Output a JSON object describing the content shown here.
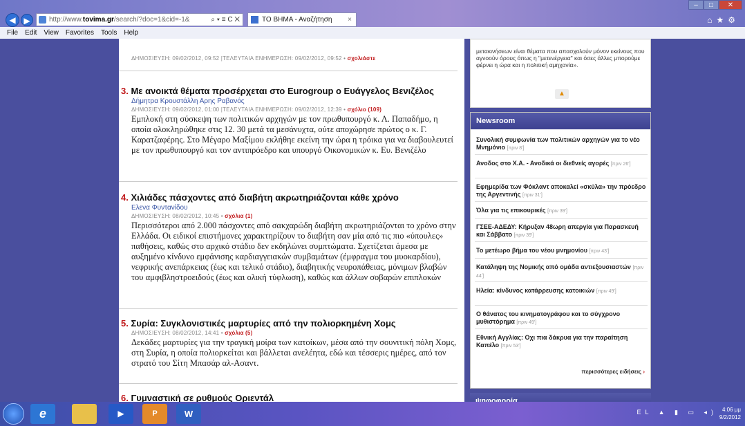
{
  "browser": {
    "address_url_prefix": "http://www.",
    "address_url_domain": "tovima.gr",
    "address_url_rest": "/search/?doc=1&cid=-1&",
    "address_controls": "⌕ ▾ ≡ C ✕",
    "tab_title": "ΤΟ ΒΗΜΑ - Αναζήτηση",
    "tab_close": "×",
    "menu": [
      "File",
      "Edit",
      "View",
      "Favorites",
      "Tools",
      "Help"
    ]
  },
  "top_meta": {
    "text": "ΔΗΜΟΣΙΕΥΣΗ: 09/02/2012, 09:52 |ΤΕΛΕΥΤΑΙΑ ΕΝΗΜΕΡΩΣΗ: 09/02/2012, 09:52 • ",
    "comments": "σχολιάστε"
  },
  "articles": [
    {
      "num": "3.",
      "title": "Με ανοικτά θέματα προσέρχεται στο Eurogroup ο Ευάγγελος Βενιζέλος",
      "author": "Δήμητρα Κρουστάλλη Αρης Ραβανός",
      "meta": "ΔΗΜΟΣΙΕΥΣΗ: 09/02/2012, 01:00 |ΤΕΛΕΥΤΑΙΑ ΕΝΗΜΕΡΩΣΗ: 09/02/2012, 12:39 • ",
      "comments": "σχόλιο (109)",
      "body": "Εμπλοκή στη σύσκεψη των πολιτικών αρχηγών με τον πρωθυπουργό κ. Λ. Παπαδήμο, η οποία ολοκληρώθηκε στις 12. 30 μετά τα μεσάνυχτα, ούτε αποχώρησε πρώτος ο κ. Γ. Καρατζαφέρης. Στο Μέγαρο Μαξίμου εκλήθηε εκείνη την ώρα η τρόικα για να διαβουλευτεί με τον πρωθυπουργό και τον αντιπρόεδρο και υπουργό Οικονομικών κ. Ευ. Βενιζέλο"
    },
    {
      "num": "4.",
      "title": "Χιλιάδες πάσχοντες από διαβήτη ακρωτηριάζονται κάθε χρόνο",
      "author": "Ελενα Φυντανίδου",
      "meta": "ΔΗΜΟΣΙΕΥΣΗ: 08/02/2012, 10:45 • ",
      "comments": "σχόλια (1)",
      "body": "Περισσότεροι από 2.000 πάσχοντες από σακχαρώδη διαβήτη ακρωτηριάζονται το χρόνο στην Ελλάδα. Οι ειδικοί επιστήμονες χαρακτηρίζουν το διαβήτη σαν μία από τις πιο «ύπουλες» παθήσεις, καθώς στο αρχικό στάδιο δεν εκδηλώνει συμπτώματα. Σχετίζεται άμεσα με αυξημένο κίνδυνο εμφάνισης καρδιαγγειακών συμβαμάτων (έμφραγμα του μυοκαρδίου), νεφρικής ανεπάρκειας (έως και τελικό στάδιο), διαβητικής νευροπάθειας, μόνιμων βλαβών του αμφιβληστροειδούς (έως και ολική τύφλωση), καθώς και άλλων σοβαρών επιπλοκών"
    },
    {
      "num": "5.",
      "title": "Συρία: Συγκλονιστικές μαρτυρίες από την πολιορκημένη Χομς",
      "author": "",
      "meta": "ΔΗΜΟΣΙΕΥΣΗ: 08/02/2012, 14:41 • ",
      "comments": "σχόλια (5)",
      "body": "Δεκάδες μαρτυρίες για την τραγική μοίρα των κατοίκων, μέσα από την σουνιτική πόλη Χομς, στη Συρία, η οποία πολιορκείται και βάλλεται ανελέητα, εδώ και τέσσερις ημέρες, από τον στρατό του Σίτη Μπασάρ αλ-Ασαντ."
    },
    {
      "num": "6.",
      "title": "Γυμναστική σε ρυθμούς Οριεντάλ",
      "author": "",
      "meta": "",
      "comments": "",
      "body": ""
    }
  ],
  "promo": {
    "text": "μετακινήσεων είναι θέματα που απασχολούν μόνον εκείνους που αγνοούν όρους όπως η \"μετενέργεια\" και όσες άλλες μπορούμε φέρνει η ώρα και η πολιτική αμηχανία»."
  },
  "newsroom": {
    "title": "Newsroom",
    "items": [
      {
        "text": "Συνολική συμφωνία των πολιτικών αρχηγών για το νέο Μνημόνιο",
        "time": "[πριν 8']"
      },
      {
        "text": "Ανοδος στο Χ.Α. - Ανοδικά οι διεθνείς αγορές",
        "time": "[πριν 26']"
      },
      {
        "text": "Εφημερίδα των Φόκλαντ αποκαλεί «σκύλα» την πρόεδρο της Αργεντινής",
        "time": "[πριν 31']"
      },
      {
        "text": "Όλα για τις επικουρικές",
        "time": "[πριν 39']"
      },
      {
        "text": "ΓΣΕΕ-ΑΔΕΔΥ: Κήρυξαν 48ωρη απεργία για Παρασκευή και Σάββατο",
        "time": "[πριν 39']"
      },
      {
        "text": "Το μετέωρο βήμα του νέου μνημονίου",
        "time": "[πριν 43']"
      },
      {
        "text": "Κατάληψη της Νομικής από ομάδα αντιεξουσιαστών",
        "time": "[πριν 44']"
      },
      {
        "text": "Ηλεία: κίνδυνος κατάρρευσης κατοικιών",
        "time": "[πριν 49']"
      },
      {
        "text": "Ο θάνατος του κινηματογράφου και το σύγχρονο μυθιστόρημα",
        "time": "[πριν 49']"
      },
      {
        "text": "Εθνική Αγγλίας: Οχι πια δάκρυα για την παραίτηση Καπέλο",
        "time": "[πριν 53']"
      }
    ],
    "more": "περισσότερες ειδήσεις",
    "more_arrow": "›"
  },
  "poll": {
    "title": "ψηφοφορία"
  },
  "taskbar": {
    "ie_label": "e",
    "media_label": "▶",
    "ppt_label": "P",
    "word_label": "W",
    "tray": "EL ▲ ▮ ▭ ◂)",
    "time": "4:06 μμ",
    "date": "9/2/2012"
  },
  "colors": {
    "accent_red": "#c0181a",
    "panel_header": "#4a4f9e",
    "link_blue": "#3a56a6"
  }
}
